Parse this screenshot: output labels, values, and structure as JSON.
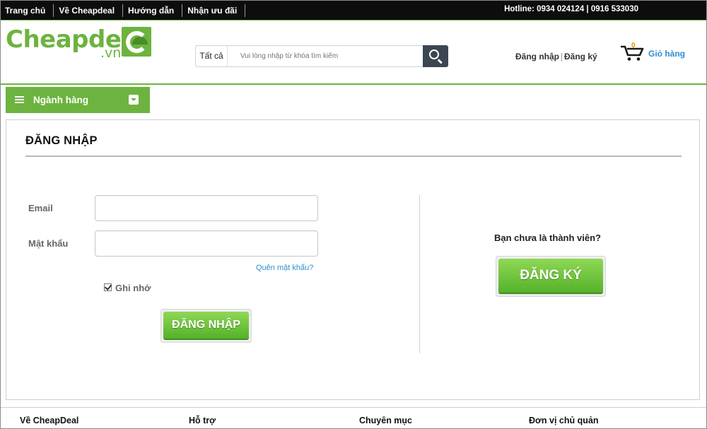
{
  "topbar": {
    "nav": [
      "Trang chủ",
      "Về Cheapdeal",
      "Hướng dẫn",
      "Nhận ưu đãi"
    ],
    "hotline": "Hotline: 0934 024124 | 0916 533030"
  },
  "header": {
    "logo_text": "Cheapdeal",
    "logo_suffix": ".vn",
    "search": {
      "category": "Tất cả",
      "placeholder": "Vui lòng nhập từ khóa tìm kiếm"
    },
    "login_link": "Đăng nhập",
    "register_link": "Đăng ký",
    "cart": {
      "count": "0",
      "label": "Giỏ hàng"
    }
  },
  "category_bar": {
    "label": "Ngành hàng"
  },
  "login": {
    "title": "ĐĂNG NHẬP",
    "email_label": "Email",
    "email_value": "",
    "password_label": "Mật khẩu",
    "password_value": "",
    "forgot": "Quên mật khẩu?",
    "remember": "Ghi nhớ",
    "remember_checked": true,
    "submit": "ĐĂNG NHẬP"
  },
  "register": {
    "question": "Bạn chưa là thành viên?",
    "button": "ĐĂNG KÝ"
  },
  "footer": {
    "columns": [
      "Về CheapDeal",
      "Hỗ trợ",
      "Chuyên mục",
      "Đơn vị chủ quản"
    ]
  },
  "colors": {
    "brand_green": "#6db33f",
    "topbar": "#0d0d0d",
    "link_blue": "#2a8fcf",
    "cart_count": "#f08a00"
  }
}
